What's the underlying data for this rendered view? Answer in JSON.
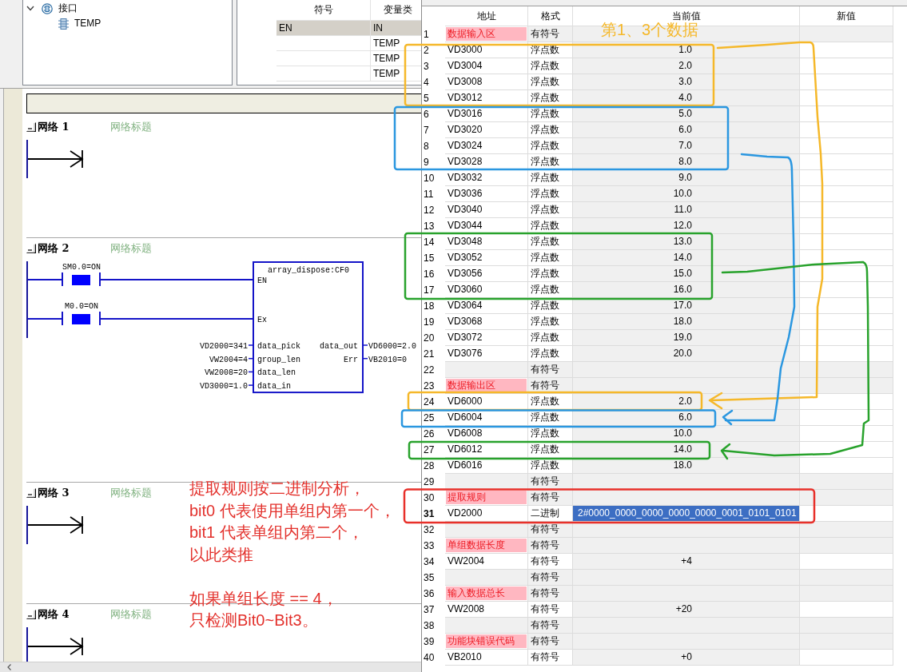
{
  "interface_tree": {
    "items": [
      {
        "label": "接口",
        "expanded": true,
        "children": [
          {
            "label": "TEMP"
          }
        ]
      }
    ]
  },
  "variable_table": {
    "columns": [
      "符号",
      "变量类"
    ],
    "rows": [
      {
        "symbol": "EN",
        "variable_type": "IN",
        "readonly": true
      },
      {
        "variable_type": "TEMP",
        "readonly": false
      },
      {
        "variable_type": "TEMP",
        "readonly": false
      },
      {
        "variable_type": "TEMP",
        "readonly": false
      }
    ]
  },
  "program_editor": {
    "networks": [
      {
        "title": "网络 1",
        "comment": "网络标题",
        "kind": "empty"
      },
      {
        "title": "网络 2",
        "comment": "网络标题",
        "kind": "block",
        "contacts": [
          {
            "label": "SM0.0=ON",
            "powered": true
          },
          {
            "label": "M0.0=ON",
            "powered": true
          }
        ],
        "block": {
          "name": "array_dispose:CF0",
          "enable_pins": [
            "EN",
            "Ex"
          ],
          "inputs": [
            {
              "pin": "data_pick",
              "operand": "VD2000=341"
            },
            {
              "pin": "group_len",
              "operand": "VW2004=4"
            },
            {
              "pin": "data_len",
              "operand": "VW2008=20"
            },
            {
              "pin": "data_in",
              "operand": "VD3000=1.0"
            }
          ],
          "outputs": [
            {
              "pin": "data_out",
              "operand": "VD6000=2.0"
            },
            {
              "pin": "Err",
              "operand": "VB2010=0"
            }
          ]
        }
      },
      {
        "title": "网络 3",
        "comment": "网络标题",
        "kind": "empty"
      },
      {
        "title": "网络 4",
        "comment": "网络标题",
        "kind": "empty"
      }
    ]
  },
  "status_chart": {
    "columns": [
      "地址",
      "格式",
      "当前值",
      "新值"
    ],
    "rows": [
      {
        "number": "1",
        "address": "数据输入区",
        "format": "有符号",
        "kind": "label",
        "selected": false
      },
      {
        "number": "2",
        "address": "VD3000",
        "format": "浮点数",
        "value": "1.0",
        "kind": "data",
        "selected": false
      },
      {
        "number": "3",
        "address": "VD3004",
        "format": "浮点数",
        "value": "2.0",
        "kind": "data",
        "selected": false
      },
      {
        "number": "4",
        "address": "VD3008",
        "format": "浮点数",
        "value": "3.0",
        "kind": "data",
        "selected": false
      },
      {
        "number": "5",
        "address": "VD3012",
        "format": "浮点数",
        "value": "4.0",
        "kind": "data",
        "selected": false
      },
      {
        "number": "6",
        "address": "VD3016",
        "format": "浮点数",
        "value": "5.0",
        "kind": "data",
        "selected": false
      },
      {
        "number": "7",
        "address": "VD3020",
        "format": "浮点数",
        "value": "6.0",
        "kind": "data",
        "selected": false
      },
      {
        "number": "8",
        "address": "VD3024",
        "format": "浮点数",
        "value": "7.0",
        "kind": "data",
        "selected": false
      },
      {
        "number": "9",
        "address": "VD3028",
        "format": "浮点数",
        "value": "8.0",
        "kind": "data",
        "selected": false
      },
      {
        "number": "10",
        "address": "VD3032",
        "format": "浮点数",
        "value": "9.0",
        "kind": "data",
        "selected": false
      },
      {
        "number": "11",
        "address": "VD3036",
        "format": "浮点数",
        "value": "10.0",
        "kind": "data",
        "selected": false
      },
      {
        "number": "12",
        "address": "VD3040",
        "format": "浮点数",
        "value": "11.0",
        "kind": "data",
        "selected": false
      },
      {
        "number": "13",
        "address": "VD3044",
        "format": "浮点数",
        "value": "12.0",
        "kind": "data",
        "selected": false
      },
      {
        "number": "14",
        "address": "VD3048",
        "format": "浮点数",
        "value": "13.0",
        "kind": "data",
        "selected": false
      },
      {
        "number": "15",
        "address": "VD3052",
        "format": "浮点数",
        "value": "14.0",
        "kind": "data",
        "selected": false
      },
      {
        "number": "16",
        "address": "VD3056",
        "format": "浮点数",
        "value": "15.0",
        "kind": "data",
        "selected": false
      },
      {
        "number": "17",
        "address": "VD3060",
        "format": "浮点数",
        "value": "16.0",
        "kind": "data",
        "selected": false
      },
      {
        "number": "18",
        "address": "VD3064",
        "format": "浮点数",
        "value": "17.0",
        "kind": "data",
        "selected": false
      },
      {
        "number": "19",
        "address": "VD3068",
        "format": "浮点数",
        "value": "18.0",
        "kind": "data",
        "selected": false
      },
      {
        "number": "20",
        "address": "VD3072",
        "format": "浮点数",
        "value": "19.0",
        "kind": "data",
        "selected": false
      },
      {
        "number": "21",
        "address": "VD3076",
        "format": "浮点数",
        "value": "20.0",
        "kind": "data",
        "selected": false
      },
      {
        "number": "22",
        "format": "有符号",
        "kind": "blank",
        "selected": false
      },
      {
        "number": "23",
        "address": "数据输出区",
        "format": "有符号",
        "kind": "label",
        "selected": false
      },
      {
        "number": "24",
        "address": "VD6000",
        "format": "浮点数",
        "value": "2.0",
        "kind": "data",
        "selected": false
      },
      {
        "number": "25",
        "address": "VD6004",
        "format": "浮点数",
        "value": "6.0",
        "kind": "data",
        "selected": false
      },
      {
        "number": "26",
        "address": "VD6008",
        "format": "浮点数",
        "value": "10.0",
        "kind": "data",
        "selected": false
      },
      {
        "number": "27",
        "address": "VD6012",
        "format": "浮点数",
        "value": "14.0",
        "kind": "data",
        "selected": false
      },
      {
        "number": "28",
        "address": "VD6016",
        "format": "浮点数",
        "value": "18.0",
        "kind": "data",
        "selected": false
      },
      {
        "number": "29",
        "format": "有符号",
        "kind": "blank",
        "selected": false
      },
      {
        "number": "30",
        "address": "提取规则",
        "format": "有符号",
        "kind": "label",
        "selected": false
      },
      {
        "number": "31",
        "address": "VD2000",
        "format": "二进制",
        "value": "2#0000_0000_0000_0000_0000_0001_0101_0101",
        "kind": "data",
        "selected": true
      },
      {
        "number": "32",
        "format": "有符号",
        "kind": "blank",
        "selected": false
      },
      {
        "number": "33",
        "address": "单组数据长度",
        "format": "有符号",
        "kind": "label",
        "selected": false
      },
      {
        "number": "34",
        "address": "VW2004",
        "format": "有符号",
        "value": "+4",
        "kind": "data",
        "selected": false
      },
      {
        "number": "35",
        "format": "有符号",
        "kind": "blank",
        "selected": false
      },
      {
        "number": "36",
        "address": "输入数据总长",
        "format": "有符号",
        "kind": "label",
        "selected": false
      },
      {
        "number": "37",
        "address": "VW2008",
        "format": "有符号",
        "value": "+20",
        "kind": "data",
        "selected": false
      },
      {
        "number": "38",
        "format": "有符号",
        "kind": "blank",
        "selected": false
      },
      {
        "number": "39",
        "address": "功能块错误代码",
        "format": "有符号",
        "kind": "label",
        "selected": false
      },
      {
        "number": "40",
        "address": "VB2010",
        "format": "有符号",
        "value": "+0",
        "kind": "data",
        "selected": false
      }
    ]
  },
  "annotations": {
    "callout": "第1、3个数据",
    "highlight_groups": [
      {
        "color": "#f5b82a"
      },
      {
        "color": "#2b97e0"
      },
      {
        "color": "#28a22c"
      }
    ],
    "rule_frame": {
      "color": "#e8302a"
    },
    "note_paragraphs": [
      [
        "提取规则按二进制分析，",
        "bit0 代表使用单组内第一个，",
        "bit1 代表单组内第二个，",
        "以此类推"
      ],
      [
        "如果单组长度 == 4，",
        "只检测Bit0~Bit3。"
      ]
    ]
  }
}
